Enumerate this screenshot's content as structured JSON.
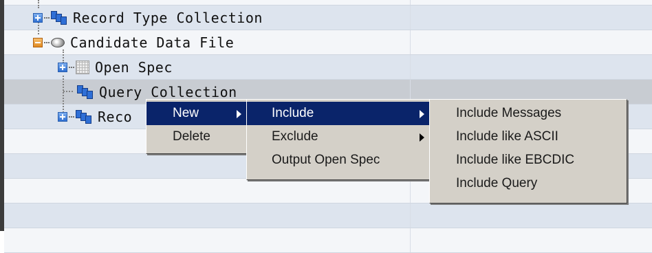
{
  "tree": {
    "nodes": [
      {
        "label": "Record Type Collection"
      },
      {
        "label": "Candidate Data File"
      },
      {
        "label": "Open Spec"
      },
      {
        "label": "Query Collection"
      },
      {
        "label": "Reco"
      }
    ]
  },
  "context_menu": {
    "items": [
      {
        "label": "New",
        "highlighted": true,
        "has_submenu": true
      },
      {
        "label": "Delete",
        "highlighted": false,
        "has_submenu": false
      }
    ]
  },
  "new_submenu": {
    "items": [
      {
        "label": "Include",
        "highlighted": true,
        "has_submenu": true
      },
      {
        "label": "Exclude",
        "highlighted": false,
        "has_submenu": true
      },
      {
        "label": "Output Open Spec",
        "highlighted": false,
        "has_submenu": false
      }
    ]
  },
  "include_submenu": {
    "items": [
      {
        "label": "Include Messages"
      },
      {
        "label": "Include like ASCII"
      },
      {
        "label": "Include like EBCDIC"
      },
      {
        "label": "Include Query"
      }
    ]
  },
  "colors": {
    "row_blue": "#dde4ee",
    "row_white": "#f4f6f9",
    "row_selected": "#c8ccd2",
    "menu_background": "#d4d0c8",
    "menu_highlight": "#0a246a"
  },
  "icons": {
    "collection": "collection-icon",
    "data_file": "disk-icon",
    "open_spec": "grid-icon",
    "expand": "expand-icon",
    "collapse": "collapse-icon"
  }
}
